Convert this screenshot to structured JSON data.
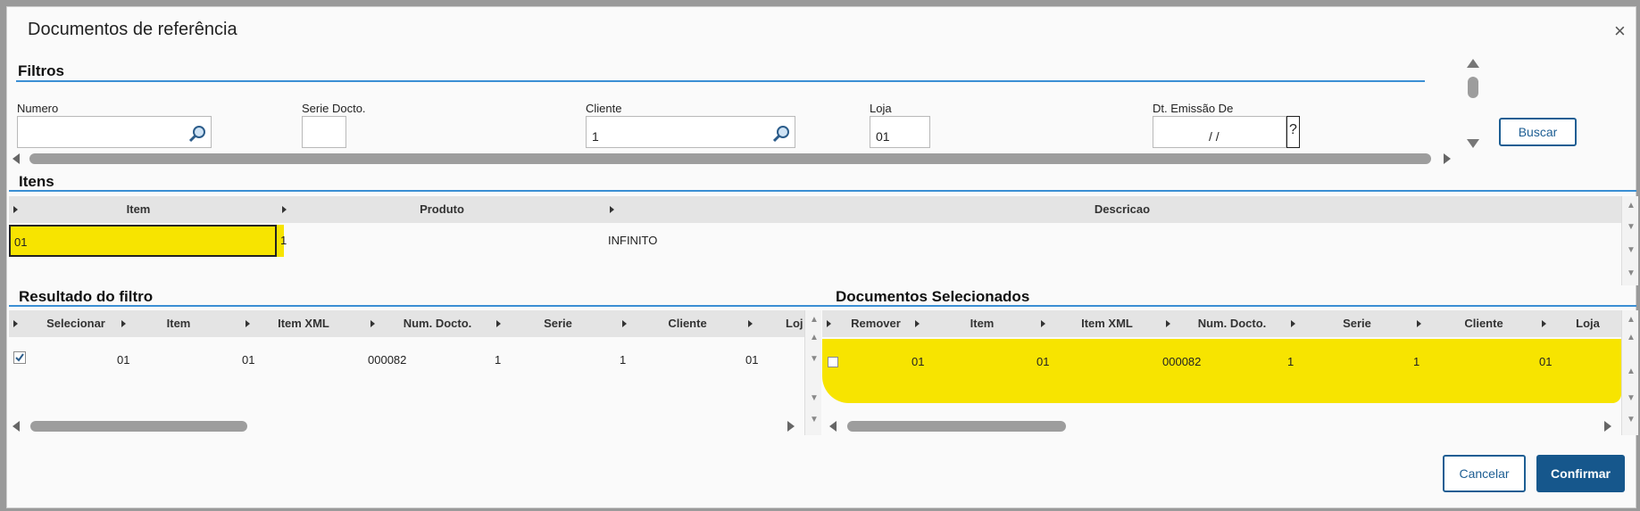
{
  "dialog": {
    "title": "Documentos de referência",
    "close": "×"
  },
  "filters": {
    "title": "Filtros",
    "numero": {
      "label": "Numero",
      "value": ""
    },
    "serie": {
      "label": "Serie Docto.",
      "value": ""
    },
    "cliente": {
      "label": "Cliente",
      "value": "1"
    },
    "loja": {
      "label": "Loja",
      "value": "01"
    },
    "dt_emissao": {
      "label": "Dt. Emissão De",
      "value": " /  /"
    },
    "help": "?",
    "search_button": "Buscar"
  },
  "itens": {
    "title": "Itens",
    "columns": [
      "Item",
      "Produto",
      "Descricao"
    ],
    "row": {
      "item": "01",
      "produto": "1",
      "descricao": "INFINITO"
    }
  },
  "resultado": {
    "title": "Resultado do filtro",
    "columns": [
      "Selecionar",
      "Item",
      "Item XML",
      "Num. Docto.",
      "Serie",
      "Cliente",
      "Loj"
    ],
    "row": {
      "item": "01",
      "item_xml": "01",
      "num_docto": "000082",
      "serie": "1",
      "cliente": "1",
      "loja": "01",
      "selected": true
    }
  },
  "selecionados": {
    "title": "Documentos Selecionados",
    "columns": [
      "Remover",
      "Item",
      "Item XML",
      "Num. Docto.",
      "Serie",
      "Cliente",
      "Loja"
    ],
    "row": {
      "item": "01",
      "item_xml": "01",
      "num_docto": "000082",
      "serie": "1",
      "cliente": "1",
      "loja": "01",
      "checked": false
    }
  },
  "footer": {
    "cancel": "Cancelar",
    "confirm": "Confirmar"
  },
  "colors": {
    "accent": "#3b8fd4",
    "primary": "#16578c",
    "highlight": "#f7e400"
  }
}
